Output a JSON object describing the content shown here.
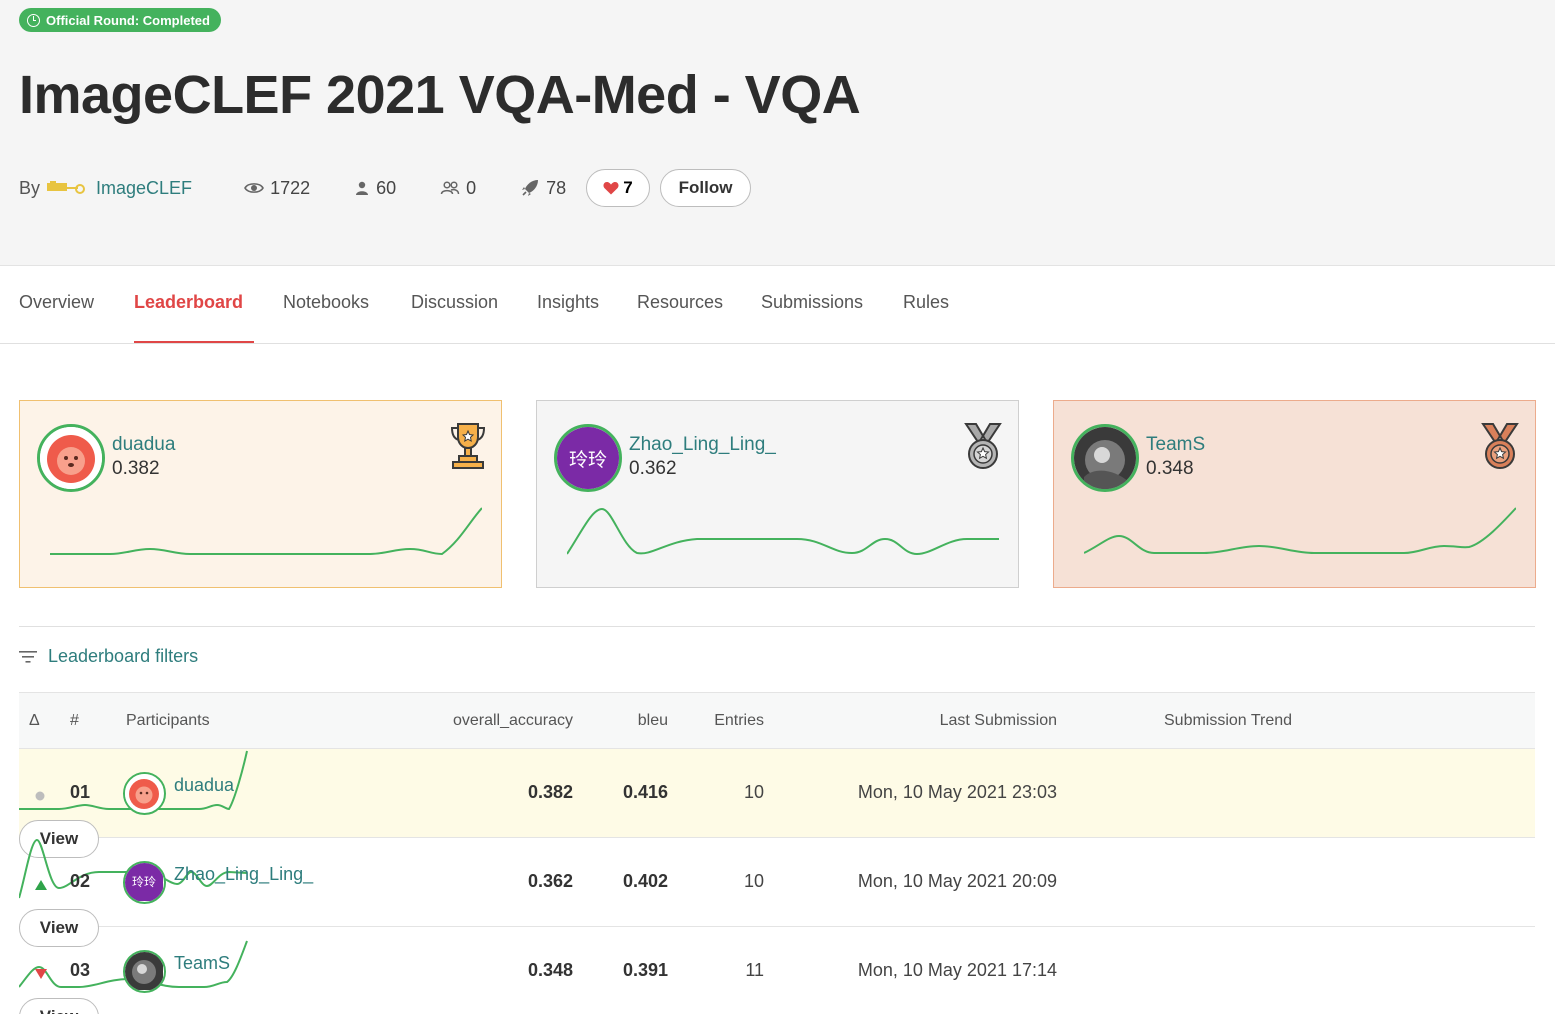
{
  "header": {
    "status": "Official Round: Completed",
    "title": "ImageCLEF 2021 VQA-Med - VQA",
    "by_label": "By",
    "organizer": "ImageCLEF",
    "views": "1722",
    "participants": "60",
    "teams": "0",
    "submissions": "78",
    "likes": "7",
    "follow_label": "Follow"
  },
  "tabs": [
    "Overview",
    "Leaderboard",
    "Notebooks",
    "Discussion",
    "Insights",
    "Resources",
    "Submissions",
    "Rules"
  ],
  "active_tab": "Leaderboard",
  "podium": [
    {
      "name": "duadua",
      "score": "0.382",
      "medal": "gold-trophy-icon"
    },
    {
      "name": "Zhao_Ling_Ling_",
      "score": "0.362",
      "medal": "silver-medal-icon",
      "avatar_text": "玲玲"
    },
    {
      "name": "TeamS",
      "score": "0.348",
      "medal": "bronze-medal-icon"
    }
  ],
  "filters_label": "Leaderboard filters",
  "table": {
    "headers": {
      "delta": "Δ",
      "rank": "#",
      "participants": "Participants",
      "accuracy": "overall_accuracy",
      "bleu": "bleu",
      "entries": "Entries",
      "last": "Last Submission",
      "trend": "Submission Trend"
    },
    "rows": [
      {
        "rank": "01",
        "delta": "same",
        "name": "duadua",
        "accuracy": "0.382",
        "bleu": "0.416",
        "entries": "10",
        "last": "Mon, 10 May 2021 23:03",
        "view": "View"
      },
      {
        "rank": "02",
        "delta": "up",
        "name": "Zhao_Ling_Ling_",
        "accuracy": "0.362",
        "bleu": "0.402",
        "entries": "10",
        "last": "Mon, 10 May 2021 20:09",
        "view": "View"
      },
      {
        "rank": "03",
        "delta": "down",
        "name": "TeamS",
        "accuracy": "0.348",
        "bleu": "0.391",
        "entries": "11",
        "last": "Mon, 10 May 2021 17:14",
        "view": "View"
      }
    ]
  },
  "colors": {
    "accent_green": "#44b25d",
    "link_teal": "#2e7d7d",
    "active_red": "#e04646",
    "delta_up": "#2fa34a",
    "delta_down": "#e04646",
    "delta_same": "#bdbdbd"
  }
}
